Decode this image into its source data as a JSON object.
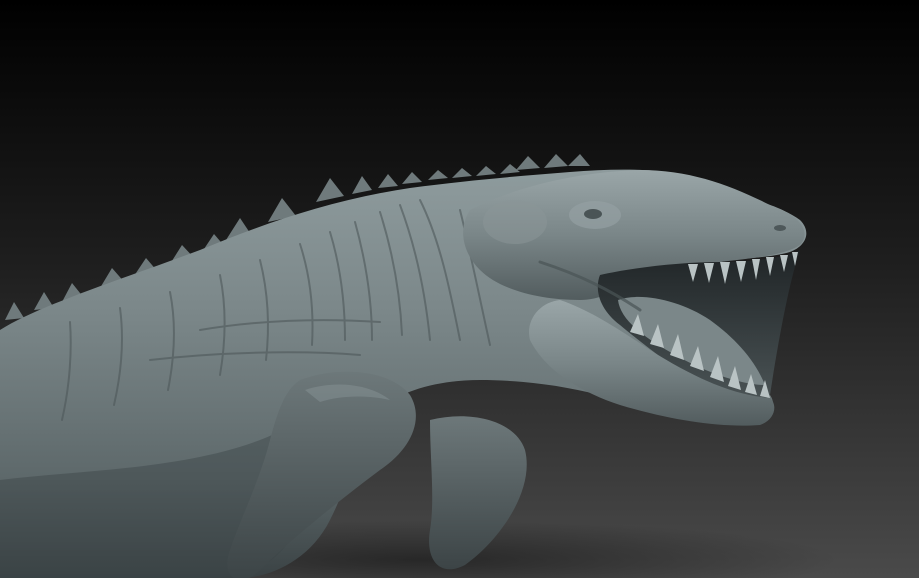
{
  "scene": {
    "subject": "mosasaur-sculpt",
    "icon": "sculpt-render",
    "colors": {
      "background_top": "#000000",
      "background_mid": "#1e1e1e",
      "background_bottom": "#4a4a4a",
      "skin_light": "#8e9b9d",
      "skin_mid": "#6a7577",
      "skin_dark": "#2c3234",
      "mouth_inner": "#1f2426",
      "teeth": "#b9c3c4"
    }
  }
}
